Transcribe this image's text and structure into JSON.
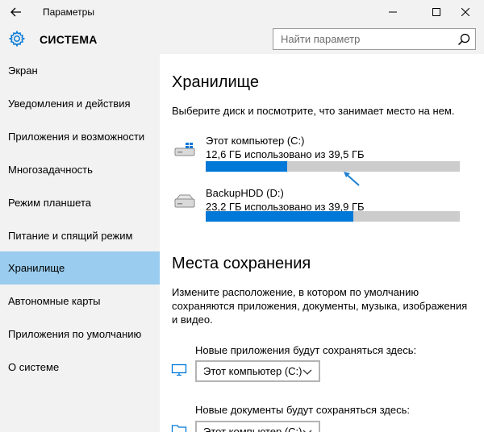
{
  "window": {
    "title": "Параметры",
    "minimize_glyph": "—",
    "maximize_glyph": "☐",
    "close_glyph": "✕"
  },
  "header": {
    "section_title": "СИСТЕМА",
    "search_placeholder": "Найти параметр"
  },
  "sidebar": {
    "items": [
      {
        "label": "Экран",
        "active": false
      },
      {
        "label": "Уведомления и действия",
        "active": false
      },
      {
        "label": "Приложения и возможности",
        "active": false
      },
      {
        "label": "Многозадачность",
        "active": false
      },
      {
        "label": "Режим планшета",
        "active": false
      },
      {
        "label": "Питание и спящий режим",
        "active": false
      },
      {
        "label": "Хранилище",
        "active": true
      },
      {
        "label": "Автономные карты",
        "active": false
      },
      {
        "label": "Приложения по умолчанию",
        "active": false
      },
      {
        "label": "О системе",
        "active": false
      }
    ]
  },
  "storage": {
    "heading": "Хранилище",
    "description": "Выберите диск и посмотрите, что занимает место на нем.",
    "drives": [
      {
        "name": "Этот компьютер (C:)",
        "usage": "12,6 ГБ использовано из 39,5 ГБ",
        "used_fraction": 0.32
      },
      {
        "name": "BackupHDD (D:)",
        "usage": "23,2 ГБ использовано из 39,9 ГБ",
        "used_fraction": 0.58
      }
    ]
  },
  "save_locations": {
    "heading": "Места сохранения",
    "description_lines": [
      "Измените расположение, в котором по умолчанию",
      "сохраняются приложения, документы, музыка, изображения",
      "и видео."
    ],
    "apps_label": "Новые приложения будут сохраняться здесь:",
    "apps_value": "Этот компьютер (C:)",
    "docs_label": "Новые документы будут сохраняться здесь:",
    "docs_value": "Этот компьютер (C:)"
  },
  "colors": {
    "accent": "#0078d7",
    "active_nav": "#99ccee",
    "bar_track": "#cccccc"
  }
}
